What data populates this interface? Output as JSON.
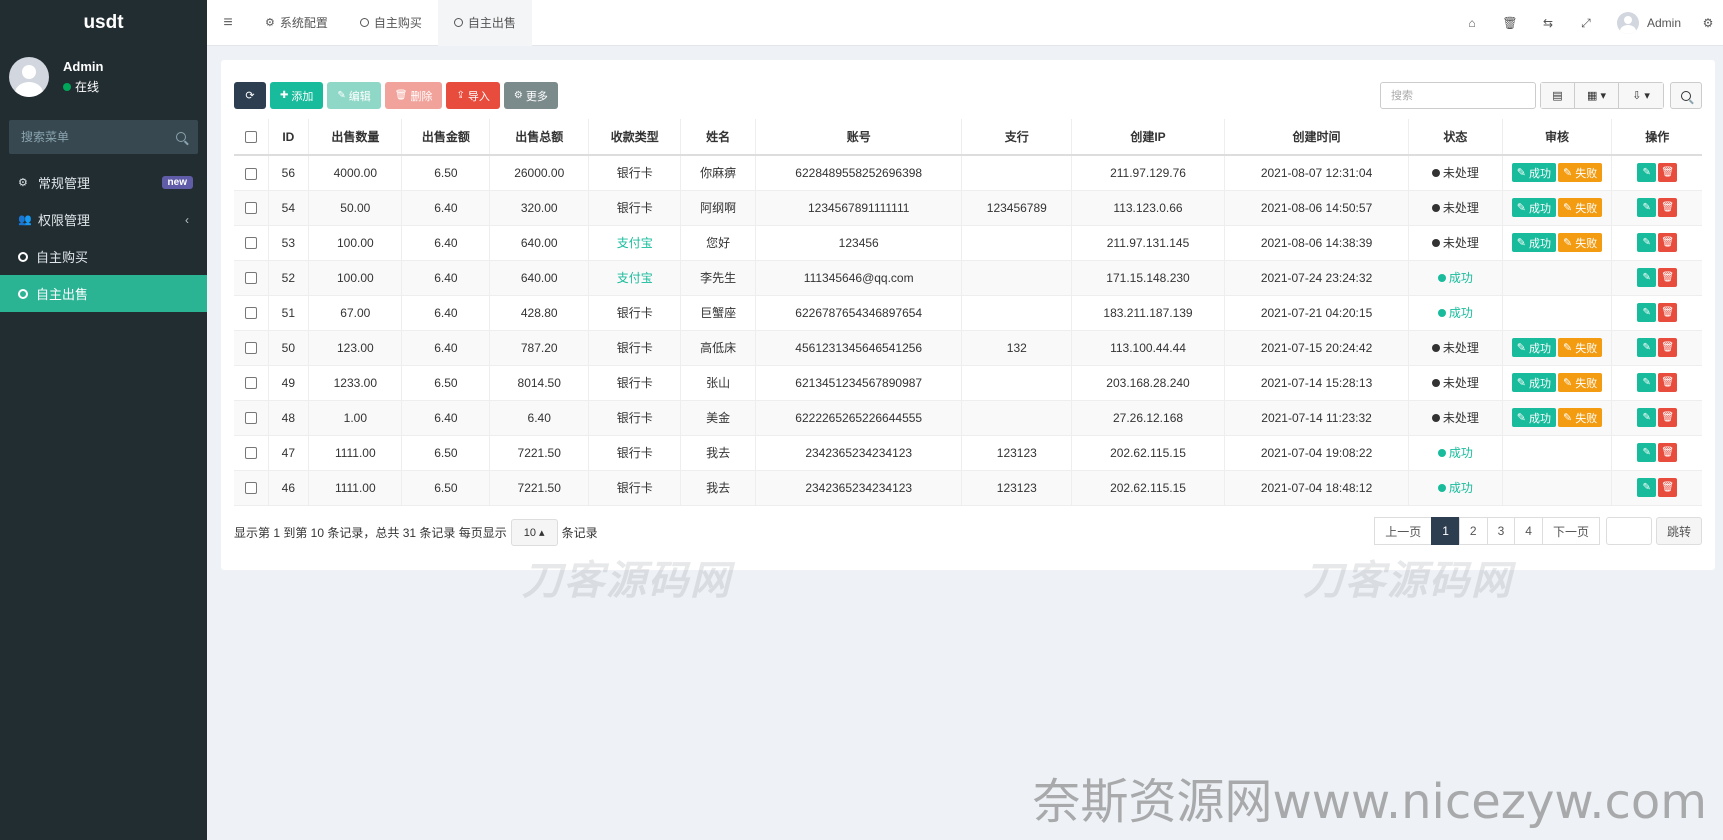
{
  "sidebar": {
    "brand": "usdt",
    "user": {
      "name": "Admin",
      "status": "在线"
    },
    "search_placeholder": "搜索菜单",
    "items": [
      {
        "label": "常规管理",
        "badge": "new"
      },
      {
        "label": "权限管理"
      },
      {
        "label": "自主购买"
      },
      {
        "label": "自主出售",
        "active": true
      }
    ]
  },
  "header": {
    "tabs": [
      {
        "label": "系统配置"
      },
      {
        "label": "自主购买"
      },
      {
        "label": "自主出售",
        "active": true
      }
    ],
    "admin_name": "Admin"
  },
  "toolbar": {
    "add": "添加",
    "edit": "编辑",
    "delete": "删除",
    "import": "导入",
    "more": "更多",
    "search_placeholder": "搜索"
  },
  "table": {
    "columns": [
      "ID",
      "出售数量",
      "出售金额",
      "出售总额",
      "收款类型",
      "姓名",
      "账号",
      "支行",
      "创建IP",
      "创建时间",
      "状态",
      "审核",
      "操作"
    ],
    "audit_ok": "成功",
    "audit_fail": "失败",
    "rows": [
      {
        "id": "56",
        "qty": "4000.00",
        "price": "6.50",
        "total": "26000.00",
        "type": "银行卡",
        "name": "你麻痹",
        "account": "6228489558252696398",
        "branch": "",
        "ip": "211.97.129.76",
        "time": "2021-08-07 12:31:04",
        "status": "未处理",
        "pending": true
      },
      {
        "id": "54",
        "qty": "50.00",
        "price": "6.40",
        "total": "320.00",
        "type": "银行卡",
        "name": "阿纲啊",
        "account": "1234567891111111",
        "branch": "123456789",
        "ip": "113.123.0.66",
        "time": "2021-08-06 14:50:57",
        "status": "未处理",
        "pending": true
      },
      {
        "id": "53",
        "qty": "100.00",
        "price": "6.40",
        "total": "640.00",
        "type": "支付宝",
        "name": "您好",
        "account": "123456",
        "branch": "",
        "ip": "211.97.131.145",
        "time": "2021-08-06 14:38:39",
        "status": "未处理",
        "pending": true
      },
      {
        "id": "52",
        "qty": "100.00",
        "price": "6.40",
        "total": "640.00",
        "type": "支付宝",
        "name": "李先生",
        "account": "111345646@qq.com",
        "branch": "",
        "ip": "171.15.148.230",
        "time": "2021-07-24 23:24:32",
        "status": "成功",
        "pending": false
      },
      {
        "id": "51",
        "qty": "67.00",
        "price": "6.40",
        "total": "428.80",
        "type": "银行卡",
        "name": "巨蟹座",
        "account": "6226787654346897654",
        "branch": "",
        "ip": "183.211.187.139",
        "time": "2021-07-21 04:20:15",
        "status": "成功",
        "pending": false
      },
      {
        "id": "50",
        "qty": "123.00",
        "price": "6.40",
        "total": "787.20",
        "type": "银行卡",
        "name": "高低床",
        "account": "4561231345646541256",
        "branch": "132",
        "ip": "113.100.44.44",
        "time": "2021-07-15 20:24:42",
        "status": "未处理",
        "pending": true
      },
      {
        "id": "49",
        "qty": "1233.00",
        "price": "6.50",
        "total": "8014.50",
        "type": "银行卡",
        "name": "张山",
        "account": "6213451234567890987",
        "branch": "",
        "ip": "203.168.28.240",
        "time": "2021-07-14 15:28:13",
        "status": "未处理",
        "pending": true
      },
      {
        "id": "48",
        "qty": "1.00",
        "price": "6.40",
        "total": "6.40",
        "type": "银行卡",
        "name": "美金",
        "account": "6222265265226644555",
        "branch": "",
        "ip": "27.26.12.168",
        "time": "2021-07-14 11:23:32",
        "status": "未处理",
        "pending": true
      },
      {
        "id": "47",
        "qty": "1111.00",
        "price": "6.50",
        "total": "7221.50",
        "type": "银行卡",
        "name": "我去",
        "account": "2342365234234123",
        "branch": "123123",
        "ip": "202.62.115.15",
        "time": "2021-07-04 19:08:22",
        "status": "成功",
        "pending": false
      },
      {
        "id": "46",
        "qty": "1111.00",
        "price": "6.50",
        "total": "7221.50",
        "type": "银行卡",
        "name": "我去",
        "account": "2342365234234123",
        "branch": "123123",
        "ip": "202.62.115.15",
        "time": "2021-07-04 18:48:12",
        "status": "成功",
        "pending": false
      }
    ]
  },
  "pagination": {
    "info_prefix": "显示第 1 到第 10 条记录，总共 31 条记录 每页显示",
    "page_size": "10",
    "info_suffix": "条记录",
    "prev": "上一页",
    "pages": [
      "1",
      "2",
      "3",
      "4"
    ],
    "current": "1",
    "next": "下一页",
    "jump": "跳转"
  },
  "watermarks": {
    "small": "刀客源码网",
    "big": "奈斯资源网www.nicezyw.com"
  }
}
